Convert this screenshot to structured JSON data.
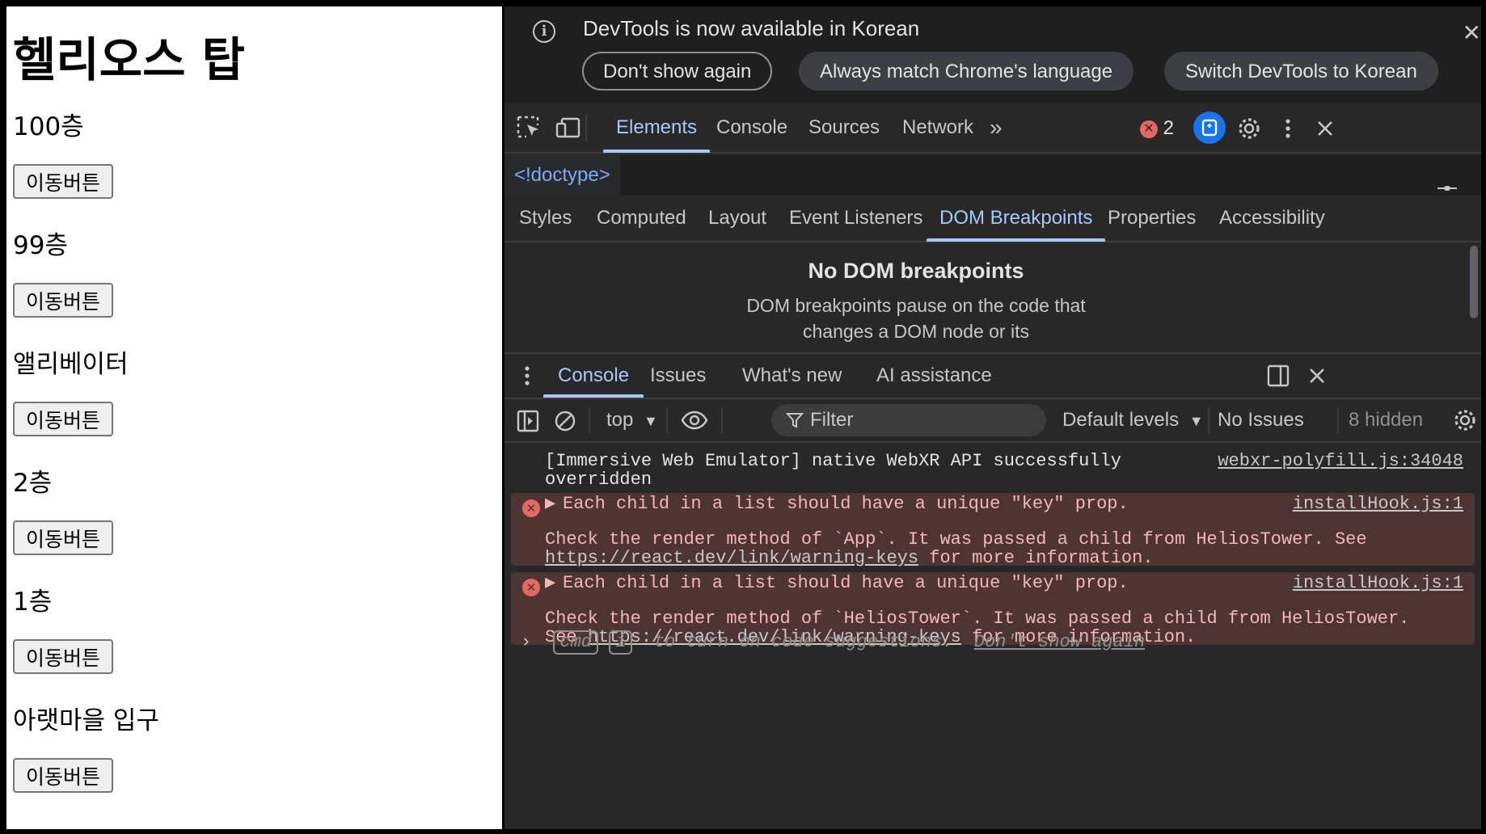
{
  "page": {
    "title": "헬리오스 탑",
    "floors": [
      {
        "name": "100층",
        "button": "이동버튼"
      },
      {
        "name": "99층",
        "button": "이동버튼"
      },
      {
        "name": "앨리베이터",
        "button": "이동버튼"
      },
      {
        "name": "2층",
        "button": "이동버튼"
      },
      {
        "name": "1층",
        "button": "이동버튼"
      },
      {
        "name": "아랫마을 입구",
        "button": "이동버튼"
      }
    ]
  },
  "devtools": {
    "infobar": {
      "message": "DevTools is now available in Korean",
      "dont_show": "Don't show again",
      "always_match": "Always match Chrome's language",
      "switch_lang": "Switch DevTools to Korean"
    },
    "main_tabs": [
      "Elements",
      "Console",
      "Sources",
      "Network"
    ],
    "error_count": "2",
    "doctype": "<!doctype>",
    "sidebar_tabs": [
      "Styles",
      "Computed",
      "Layout",
      "Event Listeners",
      "DOM Breakpoints",
      "Properties",
      "Accessibility"
    ],
    "breakpoints": {
      "title": "No DOM breakpoints",
      "desc_line1": "DOM breakpoints pause on the code that",
      "desc_line2": "changes a DOM node or its"
    },
    "drawer_tabs": [
      "Console",
      "Issues",
      "What's new",
      "AI assistance"
    ],
    "console_toolbar": {
      "context": "top",
      "filter_placeholder": "Filter",
      "levels": "Default levels",
      "issues": "No Issues",
      "hidden": "8 hidden"
    },
    "messages": {
      "info": {
        "text_line1": "[Immersive Web Emulator] native WebXR API successfully",
        "text_line2": "overridden",
        "source": "webxr-polyfill.js:34048"
      },
      "error1": {
        "summary": "Each child in a list should have a unique \"key\" prop.",
        "source": "installHook.js:1",
        "detail_line1": "Check the render method of `App`. It was passed a child from HeliosTower. See",
        "link": "https://react.dev/link/warning-keys",
        "detail_tail": " for more information."
      },
      "error2": {
        "summary": "Each child in a list should have a unique \"key\" prop.",
        "source": "installHook.js:1",
        "detail_line1": "Check the render method of `HeliosTower`. It was passed a child from HeliosTower.",
        "see": "See ",
        "link": "https://react.dev/link/warning-keys",
        "detail_tail": " for more information."
      }
    },
    "prompt": {
      "cmd": "cmd",
      "i": "i",
      "text": " to turn on code suggestions. ",
      "dont_show": "Don't show again"
    },
    "colors": {
      "accent": "#a8c7fa",
      "error_bg": "#4e3534",
      "error_icon": "#e46962",
      "panel_bg": "#282828"
    },
    "icons": [
      "inspect-icon",
      "device-toggle-icon",
      "more-tabs-icon",
      "error-icon",
      "ai-assistant-icon",
      "settings-icon",
      "kebab-menu-icon",
      "close-icon",
      "drawer-menu-icon",
      "dock-icon",
      "sidebar-toggle-icon",
      "clear-console-icon",
      "eye-icon",
      "filter-icon",
      "dropdown-icon",
      "chevron-right-icon",
      "info-icon"
    ]
  }
}
